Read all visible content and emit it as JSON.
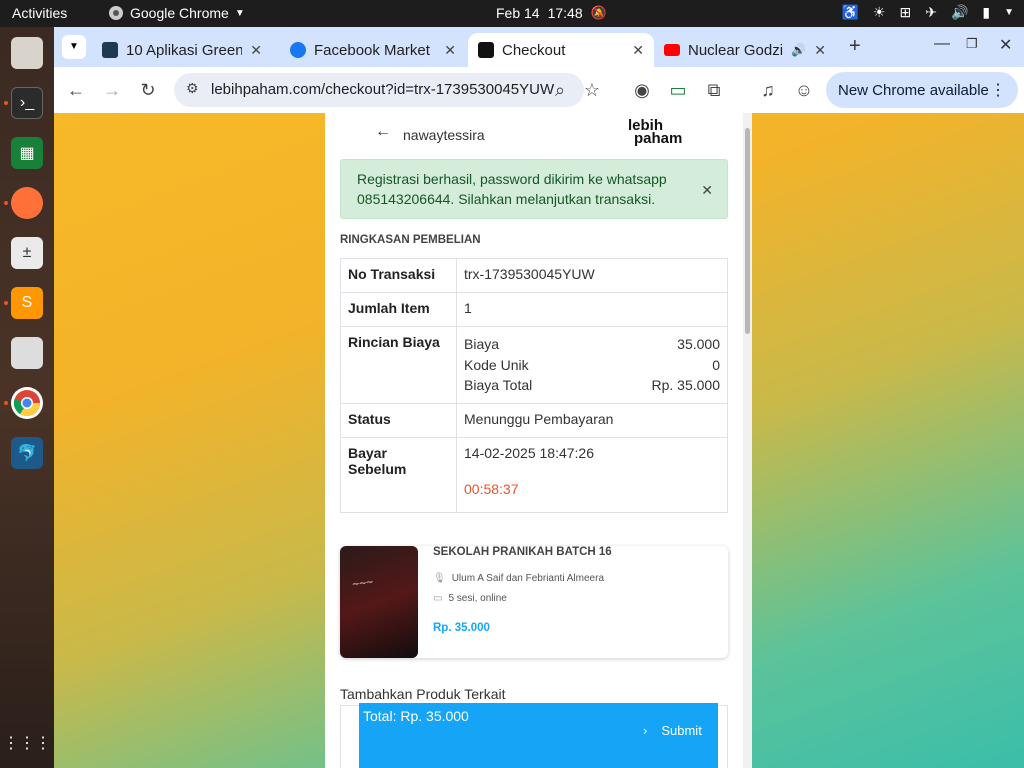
{
  "system": {
    "activities": "Activities",
    "app_name": "Google Chrome",
    "date": "Feb 14",
    "time": "17:48"
  },
  "browser": {
    "tabs": [
      {
        "title": "10 Aplikasi Green",
        "favicon_color": "#1f3a4d"
      },
      {
        "title": "Facebook Market",
        "favicon_color": "#1877f2"
      },
      {
        "title": "Checkout",
        "favicon_color": "#111111"
      },
      {
        "title": "Nuclear Godzi",
        "favicon_color": "#ff0000"
      }
    ],
    "url": "lebihpaham.com/checkout?id=trx-1739530045YUW",
    "new_chrome": "New Chrome available"
  },
  "page": {
    "username": "nawaytessira",
    "logo_top": "lebih",
    "logo_bottom": "paham",
    "alert": "Registrasi berhasil, password dikirim ke whatsapp 085143206644. Silahkan melanjutkan transaksi.",
    "section_title": "RINGKASAN PEMBELIAN",
    "summary": {
      "no_transaksi_label": "No Transaksi",
      "no_transaksi": "trx-1739530045YUW",
      "jumlah_item_label": "Jumlah Item",
      "jumlah_item": "1",
      "rincian_label": "Rincian Biaya",
      "biaya_label": "Biaya",
      "biaya": "35.000",
      "kode_unik_label": "Kode Unik",
      "kode_unik": "0",
      "biaya_total_label": "Biaya Total",
      "biaya_total": "Rp. 35.000",
      "status_label": "Status",
      "status": "Menunggu Pembayaran",
      "bayar_label": "Bayar Sebelum",
      "bayar": "14-02-2025 18:47:26",
      "countdown": "00:58:37"
    },
    "product": {
      "title": "SEKOLAH PRANIKAH BATCH 16",
      "speakers": "Ulum A Saif dan Febrianti Almeera",
      "sessions": "5 sesi, online",
      "price": "Rp. 35.000"
    },
    "related_title": "Tambahkan Produk Terkait",
    "total": "Total: Rp. 35.000",
    "submit": "Submit"
  },
  "colors": {
    "accent": "#16a5f6",
    "countdown": "#e8542a",
    "alert_bg": "#d4edda"
  }
}
